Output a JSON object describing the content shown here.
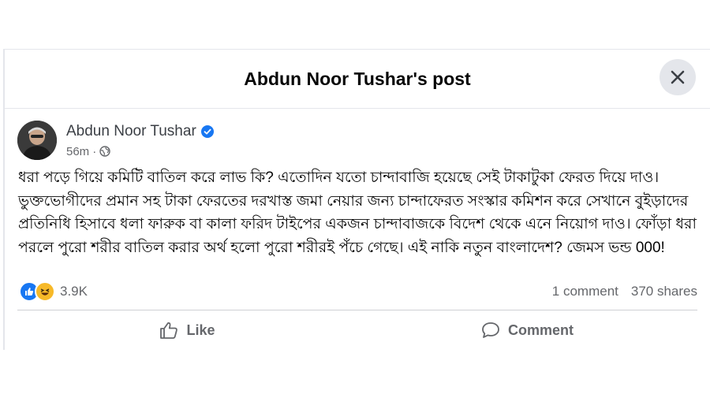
{
  "dialog": {
    "title": "Abdun Noor Tushar's post",
    "close_icon": "close-icon"
  },
  "post": {
    "author": "Abdun Noor Tushar",
    "verified_icon": "verified-badge-icon",
    "time": "56m",
    "privacy_icon": "globe-icon",
    "text": "ধরা পড়ে গিয়ে কমিটি বাতিল করে লাভ কি? এতোদিন যতো চান্দাবাজি হয়েছে সেই টাকাটুকা ফেরত দিয়ে দাও। ভুক্তভোগীদের প্রমান সহ টাকা ফেরতের দরখাস্ত জমা নেয়ার জন্য চান্দাফেরত সংস্কার কমিশন করে সেখানে বুইড়াদের প্রতিনিধি হিসাবে ধলা ফারুক বা কালা ফরিদ টাইপের একজন চান্দাবাজকে বিদেশ থেকে এনে নিয়োগ দাও। ফোঁড়া ধরা পরলে পুরো শরীর বাতিল করার অর্থ হলো পুরো শরীরই পঁচে গেছে। এই নাকি নতুন বাংলাদেশ? জেমস ভন্ড 000!"
  },
  "stats": {
    "reaction_count": "3.9K",
    "comments": "1 comment",
    "shares": "370 shares"
  },
  "actions": {
    "like": "Like",
    "comment": "Comment"
  },
  "colors": {
    "like_blue": "#1877f2",
    "haha_yellow": "#f7b928",
    "secondary_text": "#65676b"
  }
}
